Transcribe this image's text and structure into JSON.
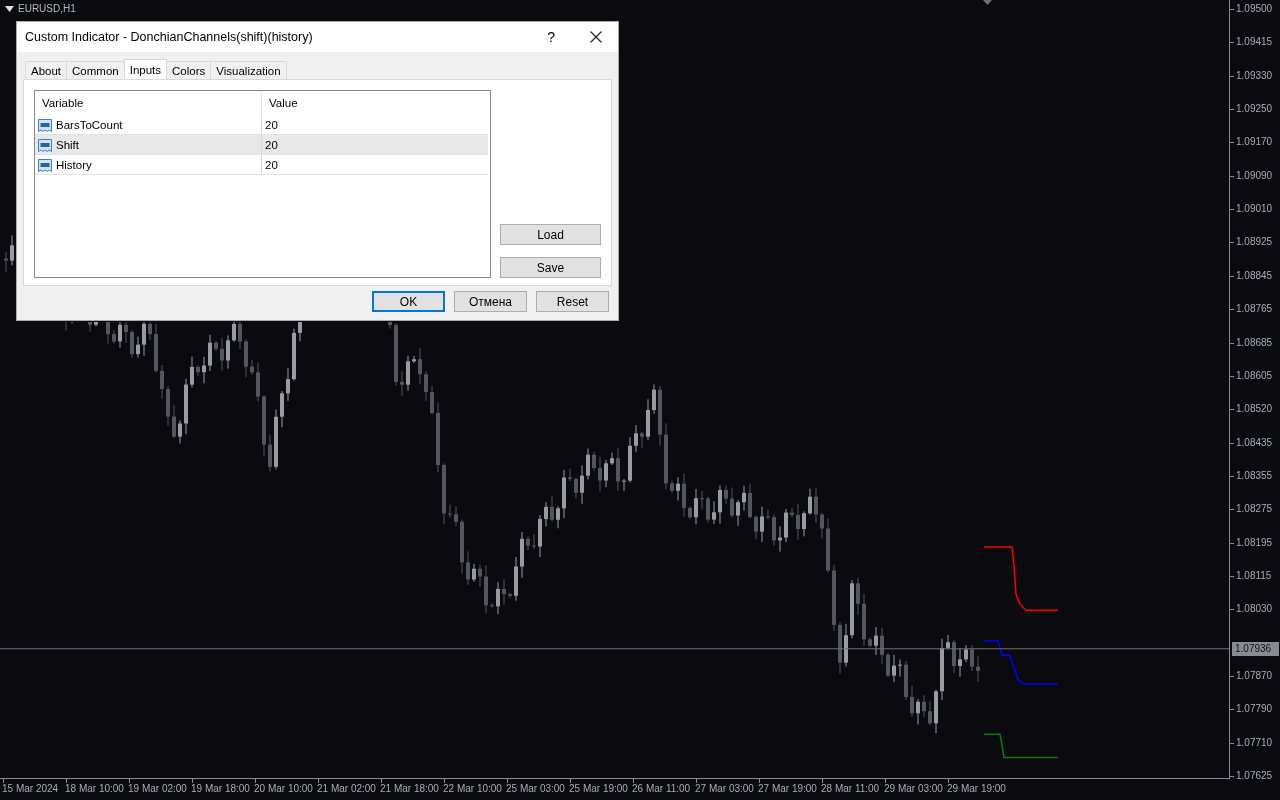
{
  "chart": {
    "symbol": "EURUSD,H1",
    "price_axis": [
      "1.09500",
      "1.09415",
      "1.09330",
      "1.09250",
      "1.09170",
      "1.09090",
      "1.09010",
      "1.08925",
      "1.08845",
      "1.08765",
      "1.08685",
      "1.08605",
      "1.08520",
      "1.08435",
      "1.08355",
      "1.08275",
      "1.08195",
      "1.08115",
      "1.08030",
      "1.07870",
      "1.07790",
      "1.07710",
      "1.07625"
    ],
    "current_price": "1.07936",
    "time_axis": [
      "15 Mar 2024",
      "18 Mar 10:00",
      "19 Mar 02:00",
      "19 Mar 18:00",
      "20 Mar 10:00",
      "21 Mar 02:00",
      "21 Mar 18:00",
      "22 Mar 10:00",
      "25 Mar 03:00",
      "25 Mar 19:00",
      "26 Mar 11:00",
      "27 Mar 03:00",
      "27 Mar 19:00",
      "28 Mar 11:00",
      "29 Mar 03:00",
      "29 Mar 19:00"
    ]
  },
  "dialog": {
    "title": "Custom Indicator - DonchianChannels(shift)(history)",
    "help": "?",
    "tabs": [
      {
        "label": "About",
        "selected": false
      },
      {
        "label": "Common",
        "selected": false
      },
      {
        "label": "Inputs",
        "selected": true
      },
      {
        "label": "Colors",
        "selected": false
      },
      {
        "label": "Visualization",
        "selected": false
      }
    ],
    "table": {
      "columns": [
        "Variable",
        "Value"
      ],
      "rows": [
        {
          "variable": "BarsToCount",
          "value": "20",
          "selected": false
        },
        {
          "variable": "Shift",
          "value": "20",
          "selected": true
        },
        {
          "variable": "History",
          "value": "20",
          "selected": false
        }
      ]
    },
    "side_buttons": [
      "Load",
      "Save"
    ],
    "buttons": [
      {
        "label": "OK",
        "default": true
      },
      {
        "label": "Отмена",
        "default": false
      },
      {
        "label": "Reset",
        "default": false
      }
    ]
  }
}
